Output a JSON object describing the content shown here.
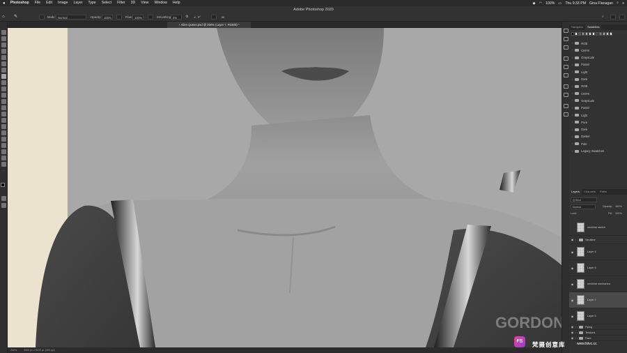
{
  "menubar": {
    "items": [
      "Photoshop",
      "File",
      "Edit",
      "Image",
      "Layer",
      "Type",
      "Select",
      "Filter",
      "3D",
      "View",
      "Window",
      "Help"
    ],
    "battery": "100%",
    "time": "Thu 9:33 PM",
    "user": "Gina Flanagan"
  },
  "app_title": "Adobe Photoshop 2020",
  "options": {
    "mode_label": "Mode:",
    "mode_value": "Normal",
    "opacity_label": "Opacity:",
    "opacity_value": "100%",
    "flow_label": "Flow:",
    "flow_value": "100%",
    "smoothing_label": "Smoothing:",
    "smoothing_value": "0%",
    "angle_value": "0°"
  },
  "document_tab": "Alien Queen.psd @ 200% (Layer 7, RGB/8) *",
  "status_bar": {
    "zoom": "200%",
    "doc_size": "3500 px x 5100 px (300 ppi)"
  },
  "swatches_panel": {
    "tabs": [
      "Navigator",
      "Swatches"
    ],
    "active_tab": "Swatches",
    "top_swatch_colors": [
      "#000000",
      "#ffffff",
      "#5a5a5a",
      "#8a8a8a",
      "#b4b4b4",
      "#d8d8d8",
      "#ffffff",
      "#3c3c3c",
      "#7a7a7a",
      "#a0a0a0",
      "#c8c8c8",
      "#ececec"
    ],
    "groups": [
      "RGB",
      "CMYK",
      "Grayscale",
      "Pastel",
      "Light",
      "Dark",
      "RGB",
      "CMYK",
      "Grayscale",
      "Pastel",
      "Light",
      "Pure",
      "Dark",
      "Darker",
      "Pale",
      "Legacy Swatches"
    ]
  },
  "layers_panel": {
    "tabs": [
      "Layers",
      "Channels",
      "Paths"
    ],
    "active_tab": "Layers",
    "kind_label": "Q Kind",
    "blend_mode": "Normal",
    "opacity_label": "Opacity:",
    "opacity_value": "100%",
    "lock_label": "Lock:",
    "fill_label": "Fill:",
    "fill_value": "100%",
    "layers": [
      {
        "name": "neckline sketch",
        "type": "layer",
        "visible": false,
        "selected": false
      },
      {
        "name": "Neckline",
        "type": "group",
        "visible": true,
        "selected": false
      },
      {
        "name": "Layer 4",
        "type": "layer",
        "visible": true,
        "selected": false
      },
      {
        "name": "Layer 6",
        "type": "layer",
        "visible": true,
        "selected": false
      },
      {
        "name": "neckline mechanics",
        "type": "layer",
        "visible": true,
        "selected": false
      },
      {
        "name": "Layer 7",
        "type": "layer",
        "visible": true,
        "selected": true
      },
      {
        "name": "Layer 5",
        "type": "layer",
        "visible": true,
        "selected": false
      },
      {
        "name": "Flying",
        "type": "group",
        "visible": true,
        "selected": false
      },
      {
        "name": "Tendons",
        "type": "group",
        "visible": true,
        "selected": false
      },
      {
        "name": "Face",
        "type": "group",
        "visible": true,
        "selected": false
      }
    ]
  },
  "watermark": {
    "logo": "FS",
    "brand": "梵摄创意库",
    "url": "www.fstvc.cc"
  },
  "canvas_watermark": "GORDON"
}
